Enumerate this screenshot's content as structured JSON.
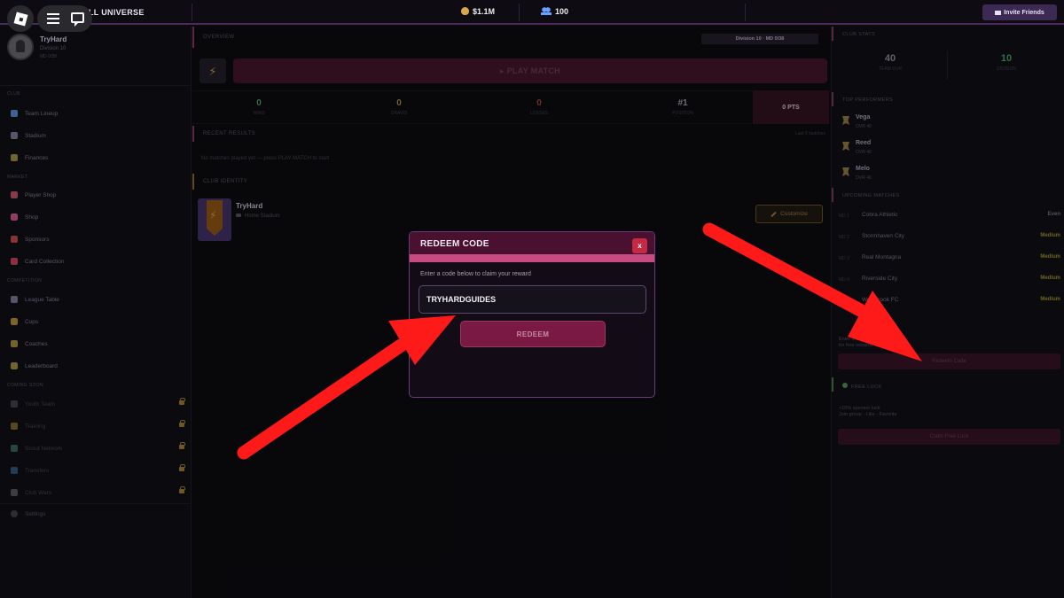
{
  "topbar": {
    "title": "LL UNIVERSE",
    "money": "$1.1M",
    "fans": "100",
    "invite_label": "Invite Friends"
  },
  "sidebar": {
    "user_name": "TryHard",
    "user_division": "Division 10",
    "user_sub": "MD 0/38",
    "sections": {
      "club": "Club",
      "market": "Market",
      "competition": "Competition",
      "coming_soon": "Coming Soon"
    },
    "club_items": [
      {
        "label": "Team Lineup",
        "icon": "shirt-icon",
        "color": "#4a7ab0"
      },
      {
        "label": "Stadium",
        "icon": "stadium-icon",
        "color": "#6a6a80"
      },
      {
        "label": "Finances",
        "icon": "money-bag-icon",
        "color": "#8a7a3a"
      }
    ],
    "market_items": [
      {
        "label": "Player Shop",
        "icon": "cart-icon",
        "color": "#a04a5a"
      },
      {
        "label": "Shop",
        "icon": "shop-icon",
        "color": "#b04a7a"
      },
      {
        "label": "Sponsors",
        "icon": "sponsor-icon",
        "color": "#a04040"
      },
      {
        "label": "Card Collection",
        "icon": "card-icon",
        "color": "#b03a4a"
      }
    ],
    "competition_items": [
      {
        "label": "League Table",
        "icon": "table-icon",
        "color": "#6a6a80"
      },
      {
        "label": "Cups",
        "icon": "trophy-icon",
        "color": "#9a7a30"
      },
      {
        "label": "Coaches",
        "icon": "coach-icon",
        "color": "#8a7a3a"
      },
      {
        "label": "Leaderboard",
        "icon": "medal-icon",
        "color": "#8a7a3a"
      }
    ],
    "coming_items": [
      {
        "label": "Youth Team",
        "icon": "youth-icon",
        "color": "#5a5a66"
      },
      {
        "label": "Training",
        "icon": "training-icon",
        "color": "#8a7a3a"
      },
      {
        "label": "Scout Network",
        "icon": "globe-icon",
        "color": "#3a7a6a"
      },
      {
        "label": "Transfers",
        "icon": "transfer-icon",
        "color": "#3a5a8a"
      },
      {
        "label": "Club Wars",
        "icon": "swords-icon",
        "color": "#6a6a70"
      }
    ],
    "settings_label": "Settings"
  },
  "main": {
    "overview_label": "OVERVIEW",
    "division_pill": "Division 10 · MD 0/38",
    "play_label": "▸ PLAY MATCH",
    "stats": [
      {
        "value": "0",
        "label": "Wins",
        "color": "#3a8a5a"
      },
      {
        "value": "0",
        "label": "Draws",
        "color": "#8a7a3a"
      },
      {
        "value": "0",
        "label": "Losses",
        "color": "#8a3a3a"
      },
      {
        "value": "#1",
        "label": "Position",
        "color": "#8a8494"
      }
    ],
    "points_label": "0 PTS",
    "recent_label": "RECENT RESULTS",
    "recent_link": "Last 5 matches",
    "recent_empty": "No matches played yet — press PLAY MATCH to start",
    "identity_label": "CLUB IDENTITY",
    "club_name": "TryHard",
    "club_stadium": "Home Stadium",
    "customize_label": "Customize"
  },
  "right": {
    "club_stats_label": "CLUB STATS",
    "club_stats": [
      {
        "value": "40",
        "label": "Team OVR",
        "color": "#7a7484"
      },
      {
        "value": "10",
        "label": "Division",
        "color": "#3a8a5a"
      }
    ],
    "performers_label": "TOP PERFORMERS",
    "performers": [
      {
        "name": "Vega",
        "ovr": "OVR 40"
      },
      {
        "name": "Reed",
        "ovr": "OVR 40"
      },
      {
        "name": "Melo",
        "ovr": "OVR 40"
      }
    ],
    "upcoming_label": "UPCOMING MATCHES",
    "matches": [
      {
        "md": "MD 1",
        "opponent": "Cobra Athletic",
        "difficulty": "Even",
        "color": "#6a6474"
      },
      {
        "md": "MD 2",
        "opponent": "Stormhaven City",
        "difficulty": "Medium",
        "color": "#8a7a2a"
      },
      {
        "md": "MD 3",
        "opponent": "Real Montagna",
        "difficulty": "Medium",
        "color": "#8a7a2a"
      },
      {
        "md": "MD 4",
        "opponent": "Riverside City",
        "difficulty": "Medium",
        "color": "#8a7a2a"
      },
      {
        "md": "MD 5",
        "opponent": "Westbrook FC",
        "difficulty": "Medium",
        "color": "#8a7a2a"
      }
    ],
    "code_hint_1": "Enter a code",
    "code_hint_2": "for free rewards",
    "redeem_btn_label": "Redeem Code",
    "free_luck_label": "FREE LUCK",
    "luck_line_1": "+10% sponsor luck",
    "luck_line_2": "Join group · Like · Favorite",
    "claim_label": "Claim Free Luck"
  },
  "modal": {
    "title": "REDEEM CODE",
    "close_label": "x",
    "hint": "Enter a code below to claim your reward",
    "code_value": "TRYHARDGUIDES",
    "redeem_label": "REDEEM"
  },
  "colors": {
    "accent": "#7a1a44",
    "annotation_arrow": "#ff1a1a"
  }
}
